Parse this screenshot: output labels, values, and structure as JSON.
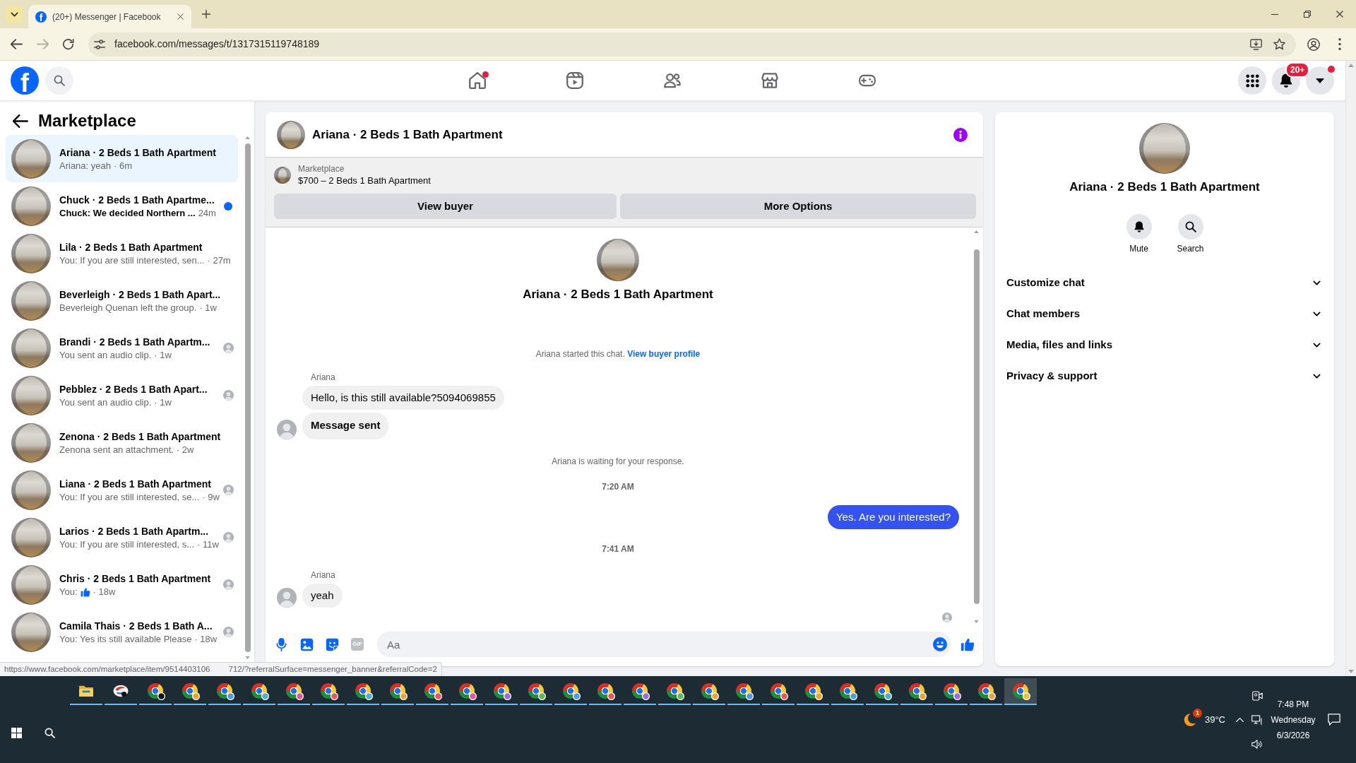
{
  "browser": {
    "tabs": [
      {
        "title": "(20+) Messenger | Facebook",
        "favicon": "f",
        "selected": true
      }
    ],
    "address": "facebook.com/messages/t/1317315119748189",
    "forward_disabled": true
  },
  "header": {
    "logo": "f",
    "nav": [
      {
        "kind": "home",
        "selected": false,
        "alert": true
      },
      {
        "kind": "video",
        "selected": false,
        "alert": false
      },
      {
        "kind": "friends",
        "selected": false,
        "alert": false
      },
      {
        "kind": "marketplace",
        "selected": false,
        "alert": false
      },
      {
        "kind": "gaming",
        "selected": false,
        "alert": false
      }
    ],
    "notifications": "20+",
    "account_alert": true
  },
  "sidebar": {
    "title": "Marketplace",
    "conversations": [
      {
        "title": "Ariana · 2 Beds 1 Bath Apartment",
        "preview": "Ariana: yeah",
        "time": "· 6m",
        "kind": "text",
        "selected": true,
        "unread": false,
        "seen": false
      },
      {
        "title": "Chuck · 2 Beds 1 Bath Apartme...",
        "preview": "Chuck: We decided Northern ...",
        "time": "24m",
        "kind": "text",
        "selected": false,
        "unread": true,
        "seen": false
      },
      {
        "title": "Lila · 2 Beds 1 Bath Apartment",
        "preview": "You: If you are still interested, sen...",
        "time": "· 27m",
        "kind": "text",
        "selected": false,
        "unread": false,
        "seen": false
      },
      {
        "title": "Beverleigh · 2 Beds 1 Bath Apart...",
        "preview": "Beverleigh Quenan left the group.",
        "time": "· 1w",
        "kind": "text",
        "selected": false,
        "unread": false,
        "seen": false
      },
      {
        "title": "Brandi · 2 Beds 1 Bath Apartm...",
        "preview": "You sent an audio clip.",
        "time": "· 1w",
        "kind": "text",
        "selected": false,
        "unread": false,
        "seen": true
      },
      {
        "title": "Pebblez · 2 Beds 1 Bath Apart...",
        "preview": "You sent an audio clip.",
        "time": "· 1w",
        "kind": "text",
        "selected": false,
        "unread": false,
        "seen": true
      },
      {
        "title": "Zenona · 2 Beds 1 Bath Apartment",
        "preview": "Zenona sent an attachment.",
        "time": "· 2w",
        "kind": "text",
        "selected": false,
        "unread": false,
        "seen": false
      },
      {
        "title": "Liana · 2 Beds 1 Bath Apartment",
        "preview": "You: If you are still interested, se...",
        "time": "· 9w",
        "kind": "text",
        "selected": false,
        "unread": false,
        "seen": true
      },
      {
        "title": "Larios · 2 Beds 1 Bath Apartm...",
        "preview": "You: If you are still interested, s...",
        "time": "· 11w",
        "kind": "text",
        "selected": false,
        "unread": false,
        "seen": true
      },
      {
        "title": "Chris · 2 Beds 1 Bath Apartment",
        "preview": "You:",
        "time": "· 18w",
        "kind": "like",
        "selected": false,
        "unread": false,
        "seen": true
      },
      {
        "title": "Camila Thais · 2 Beds 1 Bath A...",
        "preview": "You: Yes its still available Please",
        "time": "· 18w",
        "kind": "text",
        "selected": false,
        "unread": false,
        "seen": true
      }
    ]
  },
  "chat": {
    "title": "Ariana · 2 Beds 1 Bath Apartment",
    "listing": {
      "label": "Marketplace",
      "title": "$700 – 2 Beds 1 Bath Apartment",
      "buttons": [
        "View buyer",
        "More Options"
      ]
    },
    "intro": "Ariana · 2 Beds 1 Bath Apartment",
    "messages": [
      {
        "kind": "system",
        "text": "Ariana started this chat.",
        "link": "View buyer profile"
      },
      {
        "kind": "incoming",
        "sender": "Ariana",
        "bubbles": [
          {
            "text": "Hello, is this still available?5094069855",
            "bold": false
          },
          {
            "text": "Message sent",
            "bold": true
          }
        ]
      },
      {
        "kind": "system",
        "text": "Ariana is waiting for your response."
      },
      {
        "kind": "time",
        "text": "7:20 AM"
      },
      {
        "kind": "outgoing",
        "bubbles": [
          {
            "text": "Yes. Are you interested?",
            "bold": false
          }
        ]
      },
      {
        "kind": "time",
        "text": "7:41 AM"
      },
      {
        "kind": "incoming",
        "sender": "Ariana",
        "bubbles": [
          {
            "text": "yeah",
            "bold": false
          }
        ]
      }
    ],
    "read_receipt": true,
    "composer": {
      "gif": "GIF",
      "placeholder": "Aa"
    }
  },
  "details": {
    "title": "Ariana · 2 Beds 1 Bath Apartment",
    "actions": [
      {
        "kind": "mute",
        "label": "Mute"
      },
      {
        "kind": "search",
        "label": "Search"
      }
    ],
    "sections": [
      {
        "label": "Customize chat",
        "expanded": false
      },
      {
        "label": "Chat members",
        "expanded": false
      },
      {
        "label": "Media, files and links",
        "expanded": false
      },
      {
        "label": "Privacy & support",
        "expanded": false
      }
    ]
  },
  "status_url": [
    "https://www.facebook.com/marketplace/item/9514403106",
    "712/?referralSurface=messenger_banner&referralCode=2"
  ],
  "taskbar": {
    "apps": [
      {
        "kind": "folder",
        "selected": false
      },
      {
        "kind": "app",
        "selected": false
      },
      {
        "kind": "browser",
        "color": "#111111",
        "selected": false
      },
      {
        "kind": "browser",
        "color": "#e8a33d",
        "selected": false
      },
      {
        "kind": "browser",
        "color": "#4f9be0",
        "selected": false
      },
      {
        "kind": "browser",
        "color": "#4fb0c8",
        "selected": false
      },
      {
        "kind": "browser",
        "color": "#e05a9a",
        "selected": false
      },
      {
        "kind": "browser",
        "color": "#e05a5a",
        "selected": false
      },
      {
        "kind": "browser",
        "color": "#4fb0c8",
        "selected": false
      },
      {
        "kind": "browser",
        "color": "#e8a33d",
        "selected": false
      },
      {
        "kind": "browser",
        "color": "#e05a5a",
        "selected": false
      },
      {
        "kind": "browser",
        "color": "#e05a9a",
        "selected": false
      },
      {
        "kind": "browser",
        "color": "#9b6ee0",
        "selected": false
      },
      {
        "kind": "browser",
        "color": "#5cb85c",
        "selected": false
      },
      {
        "kind": "browser",
        "color": "#4f9be0",
        "selected": false
      },
      {
        "kind": "browser",
        "color": "#e05a5a",
        "selected": false
      },
      {
        "kind": "browser",
        "color": "#9b6ee0",
        "selected": false
      },
      {
        "kind": "browser",
        "color": "#5cb85c",
        "selected": false
      },
      {
        "kind": "browser",
        "color": "#e8a33d",
        "selected": false
      },
      {
        "kind": "browser",
        "color": "#4f9be0",
        "selected": false
      },
      {
        "kind": "browser",
        "color": "#e05a5a",
        "selected": false
      },
      {
        "kind": "browser",
        "color": "#e8a33d",
        "selected": false
      },
      {
        "kind": "browser",
        "color": "#4f9be0",
        "selected": false
      },
      {
        "kind": "browser",
        "color": "#4fb0c8",
        "selected": false
      },
      {
        "kind": "browser",
        "color": "#e8a33d",
        "selected": false
      },
      {
        "kind": "browser",
        "color": "#9b6ee0",
        "selected": false
      },
      {
        "kind": "browser",
        "color": "#e8a33d",
        "selected": false
      },
      {
        "kind": "browser",
        "color": "#e8c03d",
        "selected": true
      }
    ],
    "weather": {
      "temp": "39°C",
      "alerts": "1"
    },
    "clock": {
      "time": "7:48 PM",
      "day": "Wednesday",
      "date": "6/3/2026"
    }
  }
}
